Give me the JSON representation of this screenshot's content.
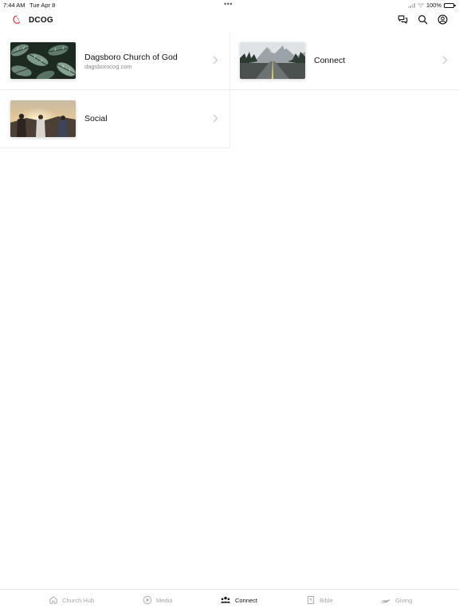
{
  "status_bar": {
    "time": "7:44 AM",
    "date": "Tue Apr 8",
    "battery": "100%",
    "dots": "•••"
  },
  "header": {
    "title": "DCOG",
    "icons": [
      "chat-icon",
      "search-icon",
      "profile-icon"
    ]
  },
  "items": [
    {
      "title": "Dagsboro Church of God",
      "subtitle": "dagsborocog.com",
      "image": "leaf-photo"
    },
    {
      "title": "Connect",
      "subtitle": "",
      "image": "road-photo"
    },
    {
      "title": "Social",
      "subtitle": "",
      "image": "people-sunset-photo"
    }
  ],
  "tabs": [
    {
      "label": "Church Hub",
      "icon": "home-icon",
      "active": false
    },
    {
      "label": "Media",
      "icon": "play-icon",
      "active": false
    },
    {
      "label": "Connect",
      "icon": "group-icon",
      "active": true
    },
    {
      "label": "Bible",
      "icon": "bible-icon",
      "active": false
    },
    {
      "label": "Giving",
      "icon": "giving-icon",
      "active": false
    }
  ],
  "colors": {
    "brand": "#d83a4a",
    "active_tab": "#111111",
    "inactive_tab": "#a5a5a5"
  }
}
